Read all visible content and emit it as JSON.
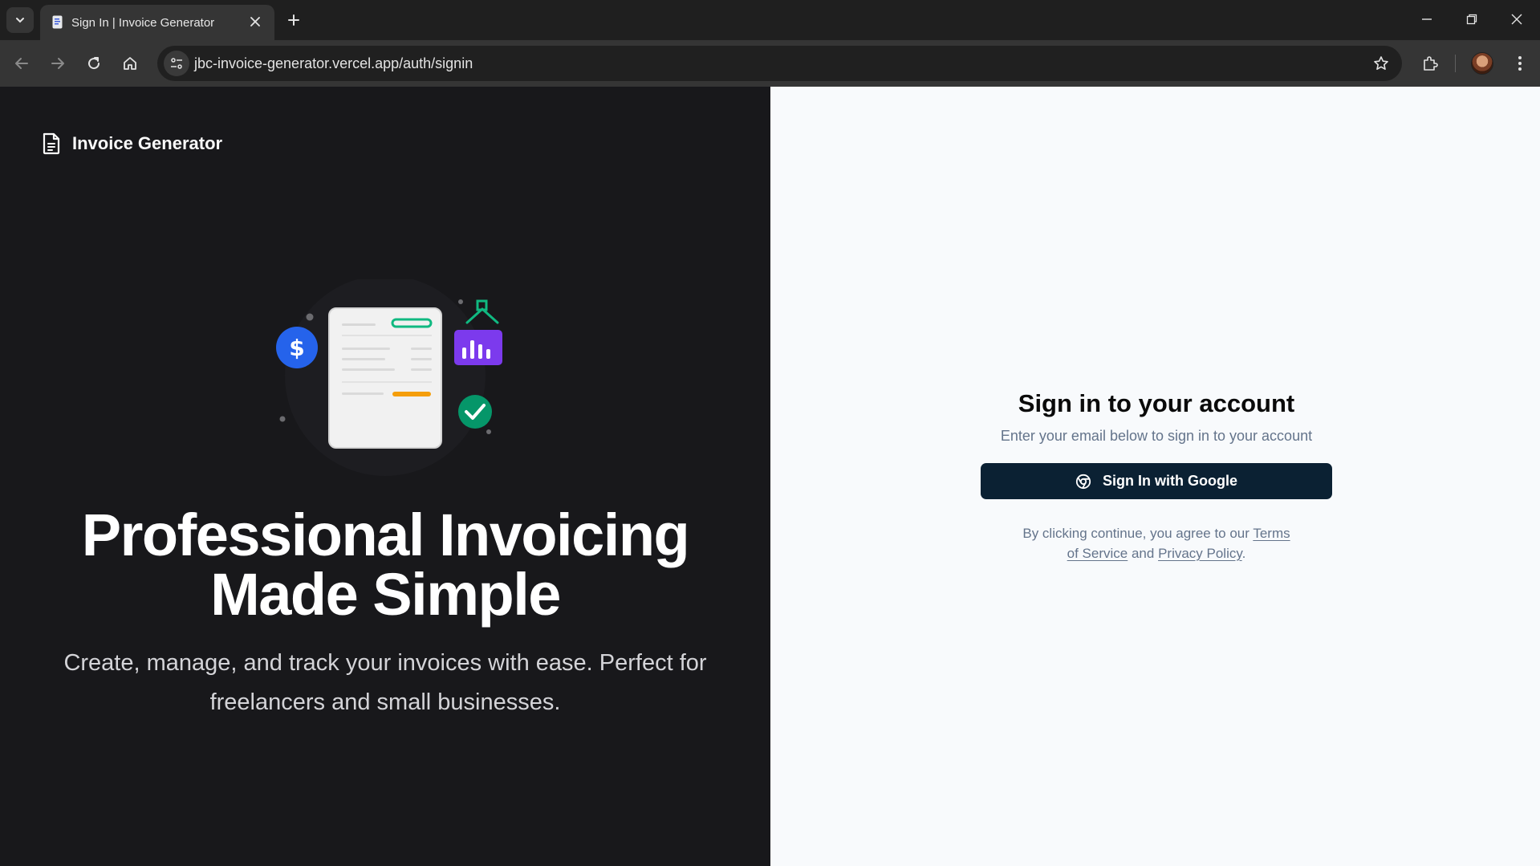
{
  "browser": {
    "tab_title": "Sign In | Invoice Generator",
    "url": "jbc-invoice-generator.vercel.app/auth/signin"
  },
  "app": {
    "brand_name": "Invoice Generator"
  },
  "hero": {
    "title_line1": "Professional Invoicing",
    "title_line2": "Made Simple",
    "subtitle_line1": "Create, manage, and track your invoices with ease. Perfect for",
    "subtitle_line2": "freelancers and small businesses."
  },
  "signin": {
    "heading": "Sign in to your account",
    "description": "Enter your email below to sign in to your account",
    "google_button_label": "Sign In with Google",
    "legal_prefix": "By clicking continue, you agree to our ",
    "terms_label": "Terms of Service",
    "legal_and": " and ",
    "privacy_label": "Privacy Policy",
    "legal_suffix": "."
  },
  "colors": {
    "left_panel_bg": "#18181b",
    "right_panel_bg": "#f8fafc",
    "primary_button": "#0b2133",
    "dollar_badge": "#2563eb",
    "chart_badge": "#7c3aed",
    "check_badge": "#059669",
    "accent_green": "#10b981",
    "accent_orange": "#f59e0b"
  },
  "icons": [
    "tab-search-icon",
    "favicon-icon",
    "close-icon",
    "plus-icon",
    "minimize-icon",
    "restore-icon",
    "back-icon",
    "forward-icon",
    "reload-icon",
    "home-icon",
    "site-info-icon",
    "star-icon",
    "extensions-icon",
    "menu-icon",
    "document-icon",
    "dollar-icon",
    "bar-chart-icon",
    "check-icon",
    "chrome-icon"
  ]
}
